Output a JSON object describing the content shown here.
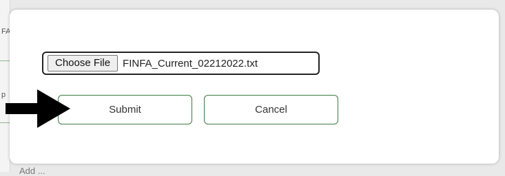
{
  "background_page": {
    "bottom_text": "Add ...",
    "edge_fragments": [
      "FA",
      "p"
    ]
  },
  "dialog": {
    "file_input": {
      "button_label": "Choose File",
      "file_name": "FINFA_Current_02212022.txt"
    },
    "submit_label": "Submit",
    "cancel_label": "Cancel"
  },
  "annotation": {
    "icon": "arrow-right-icon",
    "color": "#000000"
  },
  "colors": {
    "button_border": "#3a7a3f",
    "dialog_bg": "#ffffff"
  }
}
